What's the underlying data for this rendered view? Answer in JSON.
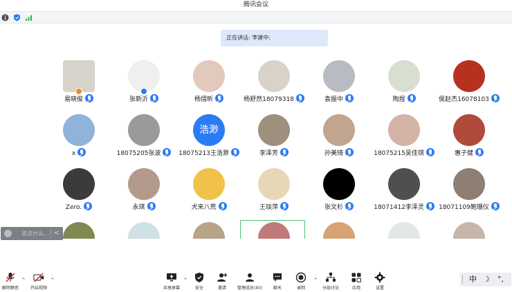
{
  "window": {
    "title": "腾讯会议"
  },
  "speaking": {
    "label": "正在讲话:",
    "names": "李建中;"
  },
  "participants": [
    {
      "name": "易晓俊",
      "role": "host",
      "av": "#d7d3cb",
      "shape": "square"
    },
    {
      "name": "张新沂",
      "role": "cohost",
      "av": "#f0efee"
    },
    {
      "name": "杨熠昕",
      "mic": true,
      "av": "#e3c8bc"
    },
    {
      "name": "杨舒然18079318",
      "mic": true,
      "av": "#d9d2c8"
    },
    {
      "name": "袁振中",
      "mic": true,
      "av": "#b8bcc2"
    },
    {
      "name": "陶煜",
      "mic": true,
      "av": "#d8dfd1"
    },
    {
      "name": "侯赵杰16078103",
      "mic": true,
      "av": "#b8301f"
    },
    {
      "name": "x",
      "mic": true,
      "av": "#8fb3d9"
    },
    {
      "name": "18075205张波",
      "mic": true,
      "av": "#9a9a9a"
    },
    {
      "name": "18075213王浩渺",
      "mic": true,
      "av": "#2b7cf4",
      "text": "浩渺"
    },
    {
      "name": "李泽芳",
      "mic": true,
      "av": "#9f8f7d"
    },
    {
      "name": "孙美琦",
      "mic": true,
      "av": "#c2a58f"
    },
    {
      "name": "18075215吴佳琪",
      "mic": true,
      "av": "#d4b4a6"
    },
    {
      "name": "惠子健",
      "mic": true,
      "av": "#b04a3b"
    },
    {
      "name": "Zero.",
      "mic": true,
      "av": "#3d3a3a"
    },
    {
      "name": "永琪",
      "mic": true,
      "av": "#b49a8c"
    },
    {
      "name": "犬来八荒",
      "mic": true,
      "av": "#f0c24a"
    },
    {
      "name": "王琰萍",
      "mic": true,
      "av": "#e7d7b7"
    },
    {
      "name": "张文杉",
      "mic": true,
      "av": "#000000"
    },
    {
      "name": "18071412李泽灵",
      "mic": true,
      "av": "#4e4f51"
    },
    {
      "name": "18071109鲍珊仪",
      "mic": true,
      "av": "#8d7f74"
    },
    {
      "name": "",
      "av": "#7f8a52"
    },
    {
      "name": "",
      "av": "#cfe0e6"
    },
    {
      "name": "",
      "av": "#b7a489"
    },
    {
      "name": "",
      "av": "#c07a7a"
    },
    {
      "name": "",
      "av": "#d6a472"
    },
    {
      "name": "",
      "av": "#e2e8e6"
    },
    {
      "name": "",
      "av": "#c6b7a9"
    }
  ],
  "chat": {
    "placeholder": "说点什么...",
    "arrow": "<"
  },
  "toolbar": {
    "unmute": "解除静音",
    "video": "开启视频",
    "share": "共享屏幕",
    "security": "安全",
    "invite": "邀请",
    "members": "管理成员(40)",
    "chat": "聊天",
    "record": "录制",
    "breakout": "分组讨论",
    "apps": "应用",
    "settings": "设置"
  },
  "ime": {
    "mode": "中",
    "moon": "☽",
    "punct": "°,"
  },
  "colors": {
    "accent": "#2b7cf4",
    "mute_red": "#e0352b"
  }
}
